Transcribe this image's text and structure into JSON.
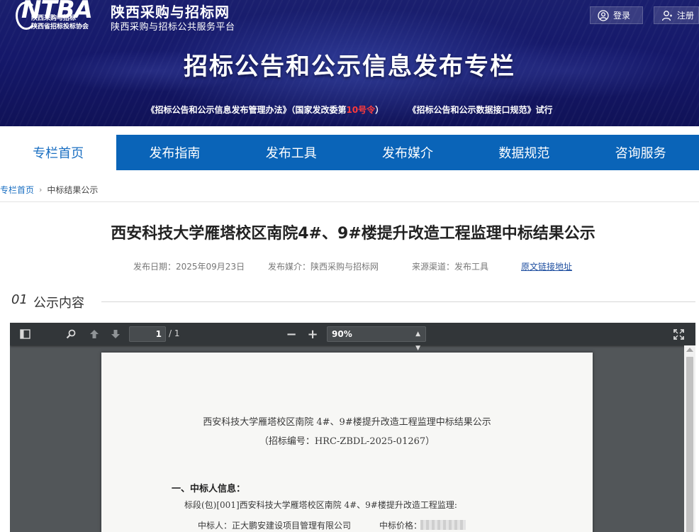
{
  "header": {
    "logo_text": "NTBA",
    "logo_sub1": "陕西采购与招标",
    "logo_sub2": "陕西省招标投标协会",
    "site_name": "陕西采购与招标网",
    "site_subtitle": "陕西采购与招标公共服务平台",
    "login_label": "登录",
    "register_label": "注册",
    "banner_title": "招标公告和公示信息发布专栏",
    "link1_pre": "《招标公告和公示信息发布管理办法》（国家发改委第",
    "link1_red": "10号令",
    "link1_post": "）",
    "link2": "《招标公告和公示数据接口规范》试行"
  },
  "nav": {
    "items": [
      {
        "label": "专栏首页"
      },
      {
        "label": "发布指南"
      },
      {
        "label": "发布工具"
      },
      {
        "label": "发布媒介"
      },
      {
        "label": "数据规范"
      },
      {
        "label": "咨询服务"
      }
    ]
  },
  "breadcrumb": {
    "home": "专栏首页",
    "current": "中标结果公示"
  },
  "article": {
    "title": "西安科技大学雁塔校区南院4#、9#楼提升改造工程监理中标结果公示",
    "publish_date": "发布日期：2025年09月23日",
    "publish_media": "发布媒介：陕西采购与招标网",
    "source_channel": "来源渠道：发布工具",
    "original_link": "原文链接地址"
  },
  "section": {
    "number": "01",
    "title": "公示内容"
  },
  "pdf_viewer": {
    "page_current": "1",
    "page_total": "/ 1",
    "zoom": "90%",
    "doc": {
      "title": "西安科技大学雁塔校区南院 4#、9#楼提升改造工程监理中标结果公示",
      "code": "（招标编号：HRC-ZBDL-2025-01267）",
      "section1": "一、中标人信息：",
      "lot": "标段(包)[001]西安科技大学雁塔校区南院 4#、9#楼提升改造工程监理:",
      "winner": "中标人：正大鹏安建设项目管理有限公司",
      "price_label": "中标价格："
    }
  },
  "colors": {
    "nav_blue": "#0a64b8",
    "banner_navy": "#15186a",
    "highlight_red": "#ff3b3b",
    "link_blue": "#1f4fa0"
  }
}
